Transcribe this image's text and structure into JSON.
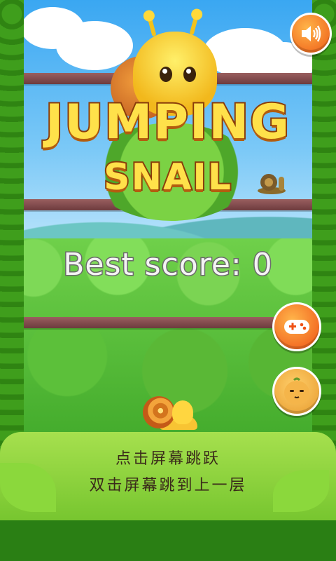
{
  "game": {
    "title_line1": "JUMPING",
    "title_line2": "SNAIL",
    "best_score_label": "Best score:",
    "best_score_value": "0",
    "instructions": [
      "点击屏幕跳跃",
      "双击屏幕跳到上一层"
    ]
  },
  "buttons": {
    "sound": {
      "icon": "speaker-icon"
    },
    "play": {
      "icon": "gamepad-icon"
    },
    "character": {
      "icon": "face-icon"
    }
  },
  "colors": {
    "button_orange": "#ee5a15",
    "title_yellow": "#ffe14a",
    "title_outline": "#8a3d0a",
    "grass": "#2f9a1e"
  }
}
